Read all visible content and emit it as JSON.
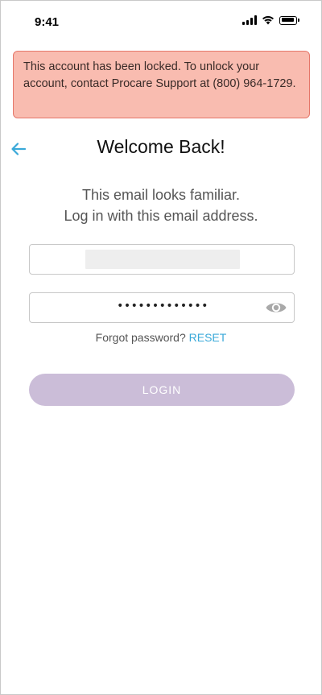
{
  "status_bar": {
    "time": "9:41",
    "icons": [
      "signal-icon",
      "wifi-icon",
      "battery-icon"
    ]
  },
  "alert": {
    "message": "This account has been locked. To unlock your account, contact Procare Support at (800) 964-1729.",
    "background_color": "#f9bcb0",
    "border_color": "#e5776a"
  },
  "header": {
    "back_icon": "arrow-left-icon",
    "title": "Welcome Back!"
  },
  "subtitle": {
    "line1": "This email looks familiar.",
    "line2": "Log in with this email address."
  },
  "email_field": {
    "value": ""
  },
  "password_field": {
    "masked_value": "•••••••••••••",
    "toggle_icon": "eye-icon"
  },
  "forgot": {
    "text": "Forgot password?",
    "link": "RESET"
  },
  "login_button": {
    "label": "LOGIN",
    "color": "#cbbdd8"
  },
  "accent_color": "#3aa9d9"
}
